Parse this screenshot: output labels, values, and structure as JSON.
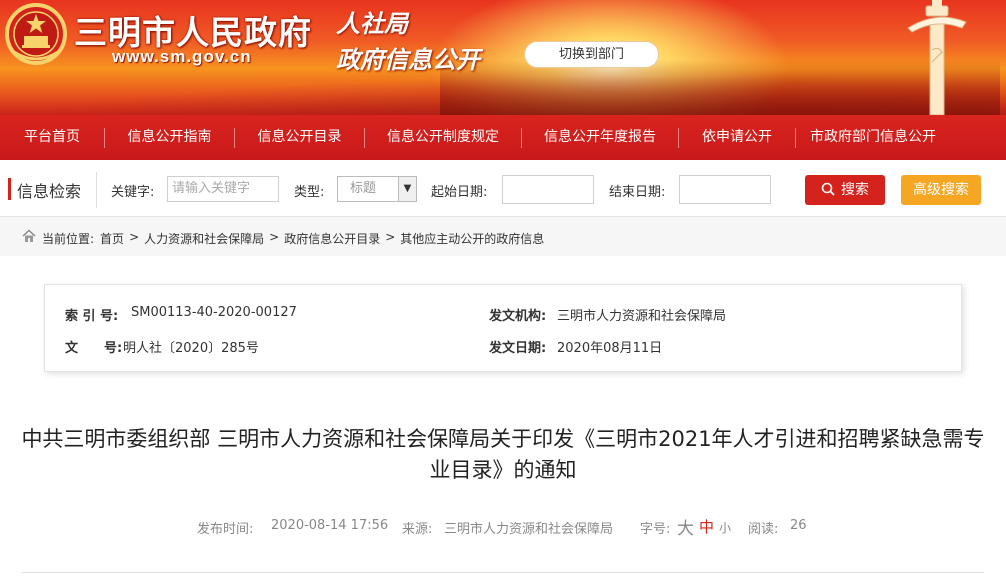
{
  "header": {
    "site_name": "三明市人民政府",
    "site_url": "www.sm.gov.cn",
    "dept_title": "人社局",
    "dept_subtitle": "政府信息公开",
    "switch_label": "切换到部门"
  },
  "nav": {
    "items": [
      {
        "label": "平台首页"
      },
      {
        "label": "信息公开指南"
      },
      {
        "label": "信息公开目录"
      },
      {
        "label": "信息公开制度规定"
      },
      {
        "label": "信息公开年度报告"
      },
      {
        "label": "依申请公开"
      },
      {
        "label": "市政府部门信息公开"
      }
    ]
  },
  "search": {
    "title": "信息检索",
    "keyword_label": "关键字:",
    "keyword_placeholder": "请输入关键字",
    "type_label": "类型:",
    "type_value": "标题",
    "start_label": "起始日期:",
    "end_label": "结束日期:",
    "search_btn": "搜索",
    "advanced_btn": "高级搜索"
  },
  "breadcrumb": {
    "prefix": "当前位置:",
    "items": [
      "首页",
      "人力资源和社会保障局",
      "政府信息公开目录",
      "其他应主动公开的政府信息"
    ],
    "sep": ">"
  },
  "meta": {
    "index_label": "索 引 号:",
    "index_value": "SM00113-40-2020-00127",
    "issuer_label": "发文机构:",
    "issuer_value": "三明市人力资源和社会保障局",
    "docno_label": "文　　号:",
    "docno_value": "明人社〔2020〕285号",
    "date_label": "发文日期:",
    "date_value": "2020年08月11日"
  },
  "article": {
    "title": "中共三明市委组织部 三明市人力资源和社会保障局关于印发《三明市2021年人才引进和招聘紧缺急需专业目录》的通知",
    "publish_label": "发布时间:",
    "publish_value": "2020-08-14 17:56",
    "source_label": "来源:",
    "source_value": "三明市人力资源和社会保障局",
    "fontsize_label": "字号:",
    "size_large": "大",
    "size_medium": "中",
    "size_small": "小",
    "views_label": "阅读:",
    "views_value": "26"
  },
  "colors": {
    "brand_red": "#d4231c",
    "accent_orange": "#f5a623"
  }
}
